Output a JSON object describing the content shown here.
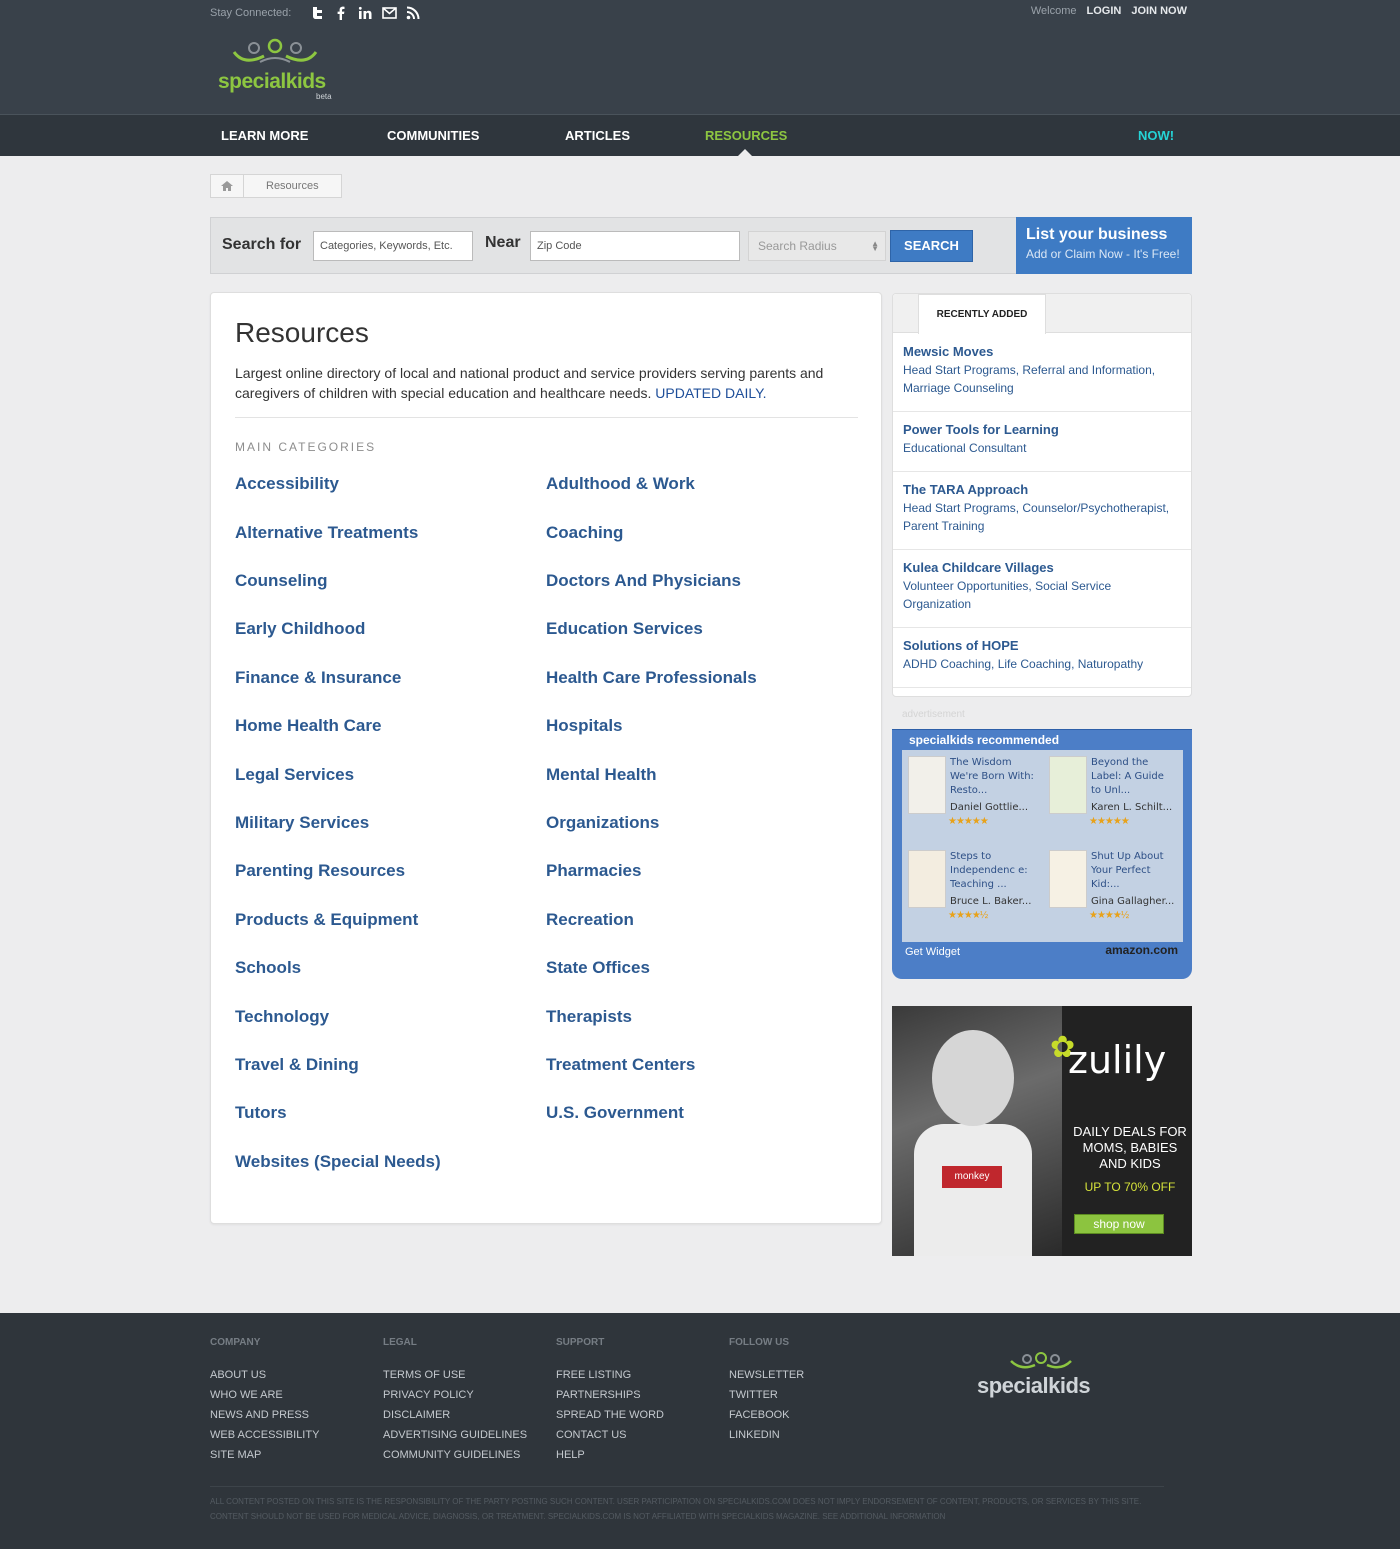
{
  "topbar": {
    "stay_connected": "Stay Connected:",
    "social_icons": [
      "twitter-icon",
      "facebook-icon",
      "linkedin-icon",
      "email-icon",
      "rss-icon"
    ],
    "welcome": "Welcome",
    "login": "LOGIN",
    "join": "JOIN NOW"
  },
  "logo": {
    "name": "specialkids",
    "beta": "beta"
  },
  "nav": {
    "items": [
      "LEARN MORE",
      "COMMUNITIES",
      "ARTICLES",
      "RESOURCES"
    ],
    "active": "RESOURCES",
    "now": "NOW!"
  },
  "breadcrumb": {
    "current": "Resources"
  },
  "search": {
    "search_for_label": "Search for",
    "keyword_placeholder": "Categories, Keywords, Etc.",
    "near_label": "Near",
    "zip_placeholder": "Zip Code",
    "radius_placeholder": "Search Radius",
    "button": "SEARCH"
  },
  "list_business": {
    "title": "List your business",
    "subtitle": "Add or Claim Now - It's Free!"
  },
  "main": {
    "title": "Resources",
    "description": "Largest online directory of local and national product and service providers serving parents and caregivers of children with special education and healthcare needs.",
    "updated": "UPDATED DAILY.",
    "categories_heading": "MAIN CATEGORIES",
    "categories_left": [
      "Accessibility",
      "Alternative Treatments",
      "Counseling",
      "Early Childhood",
      "Finance & Insurance",
      "Home Health Care",
      "Legal Services",
      "Military Services",
      "Parenting Resources",
      "Products & Equipment",
      "Schools",
      "Technology",
      "Travel & Dining",
      "Tutors",
      "Websites (Special Needs)"
    ],
    "categories_right": [
      "Adulthood & Work",
      "Coaching",
      "Doctors And Physicians",
      "Education Services",
      "Health Care Professionals",
      "Hospitals",
      "Mental Health",
      "Organizations",
      "Pharmacies",
      "Recreation",
      "State Offices",
      "Therapists",
      "Treatment Centers",
      "U.S. Government"
    ]
  },
  "recent": {
    "tab": "RECENTLY ADDED",
    "items": [
      {
        "name": "Mewsic Moves",
        "cats": "Head Start Programs, Referral and Information, Marriage Counseling"
      },
      {
        "name": "Power Tools for Learning",
        "cats": "Educational Consultant"
      },
      {
        "name": "The TARA Approach",
        "cats": "Head Start Programs, Counselor/Psychotherapist, Parent Training"
      },
      {
        "name": "Kulea Childcare Villages",
        "cats": "Volunteer Opportunities, Social Service Organization"
      },
      {
        "name": "Solutions of HOPE",
        "cats": "ADHD Coaching, Life Coaching, Naturopathy"
      }
    ]
  },
  "ad": {
    "label": "advertisement",
    "widget_title": "specialkids recommended",
    "books": [
      {
        "title": "The Wisdom We're Born With: Resto...",
        "author": "Daniel Gottlie...",
        "stars": "★★★★★"
      },
      {
        "title": "Beyond the Label: A Guide to Unl...",
        "author": "Karen L. Schilt...",
        "stars": "★★★★★"
      },
      {
        "title": "Steps to Independenc e: Teaching ...",
        "author": "Bruce L. Baker...",
        "stars": "★★★★½"
      },
      {
        "title": "Shut Up About Your Perfect Kid:...",
        "author": "Gina Gallagher...",
        "stars": "★★★★½"
      }
    ],
    "get_widget": "Get Widget",
    "amazon": "amazon.com"
  },
  "zulily": {
    "brand": "zulily",
    "patch": "monkey",
    "tagline": "DAILY DEALS FOR MOMS, BABIES AND KIDS",
    "discount": "UP TO 70% OFF",
    "button": "shop now"
  },
  "footer": {
    "company": {
      "heading": "COMPANY",
      "links": [
        "ABOUT US",
        "WHO WE ARE",
        "NEWS AND PRESS",
        "WEB ACCESSIBILITY",
        "SITE MAP"
      ]
    },
    "legal": {
      "heading": "LEGAL",
      "links": [
        "TERMS OF USE",
        "PRIVACY POLICY",
        "DISCLAIMER",
        "ADVERTISING GUIDELINES",
        "COMMUNITY GUIDELINES"
      ]
    },
    "support": {
      "heading": "SUPPORT",
      "links": [
        "FREE LISTING",
        "PARTNERSHIPS",
        "SPREAD THE WORD",
        "CONTACT US",
        "HELP"
      ]
    },
    "follow": {
      "heading": "FOLLOW US",
      "links": [
        "NEWSLETTER",
        "TWITTER",
        "FACEBOOK",
        "LINKEDIN"
      ]
    },
    "logo": "specialkids",
    "disclaimer": "ALL CONTENT POSTED ON THIS SITE IS THE RESPONSIBILITY OF THE PARTY POSTING SUCH CONTENT. USER PARTICIPATION ON SPECIALKIDS.COM DOES NOT IMPLY ENDORSEMENT OF CONTENT, PRODUCTS, OR SERVICES BY THIS SITE. CONTENT SHOULD NOT BE USED FOR MEDICAL ADVICE, DIAGNOSIS, OR TREATMENT. SPECIALKIDS.COM IS NOT AFFILIATED WITH SPECIALKIDS MAGAZINE. SEE ADDITIONAL INFORMATION"
  },
  "colors": {
    "accent_green": "#8dc641",
    "link_blue": "#2c5990",
    "button_blue": "#3e7bc4",
    "now_cyan": "#25d3d6"
  }
}
